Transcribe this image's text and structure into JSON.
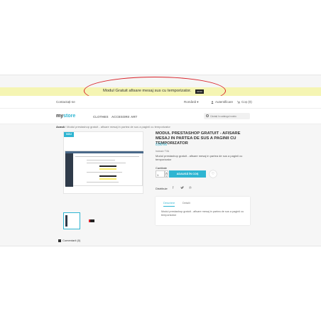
{
  "promo": {
    "message": "Modul Gratuit afisare mesaj sus cu temporizator.",
    "timer": "00:00"
  },
  "topbar": {
    "contact": "Contactați-ne",
    "language": "Română ▾",
    "login": "Autentificare",
    "cart": "Coș (0)"
  },
  "header": {
    "logo_prefix": "my",
    "logo_accent": "store",
    "nav": [
      "CLOTHES",
      "ACCESORII",
      "ART"
    ],
    "search_placeholder": "Căutați în catalogul nostru"
  },
  "breadcrumb": {
    "home": "Acasă",
    "separator": "/",
    "current": "Modul prestashop gratuit - afisare mesaj in partea de sus a paginii cu temporizator"
  },
  "product": {
    "badge": "NOU",
    "title": "MODUL PRESTASHOP GRATUIT - AFISARE MESAJ IN PARTEA DE SUS A PAGINII CU TEMPORIZATOR",
    "price": "0,00 lei",
    "tax": "Inclusiv TVA",
    "short_description": "Modul prestashop gratuit - afisare mesaj in partea de sus a paginii cu temporizator",
    "quantity_label": "Cantitate",
    "quantity_value": "1",
    "add_to_cart": "ADAUGĂ ÎN COȘ",
    "share_label": "Distribuie"
  },
  "tabs": {
    "description_label": "Descriere",
    "details_label": "Detalii",
    "content": "Modul prestashop gratuit - afisare mesaj in partea de sus a paginii cu temporizator"
  },
  "comments": {
    "label": "Comentarii (0)"
  },
  "colors": {
    "accent": "#2fb5d2",
    "promo_background": "#f5f5b3",
    "annotation_red": "#d9242b"
  },
  "icons": {
    "user": "user-icon",
    "cart": "cart-icon",
    "search": "search-icon",
    "wishlist": "heart-icon",
    "facebook": "facebook-icon",
    "twitter": "twitter-icon",
    "pinterest": "pinterest-icon",
    "comment": "comment-icon"
  }
}
